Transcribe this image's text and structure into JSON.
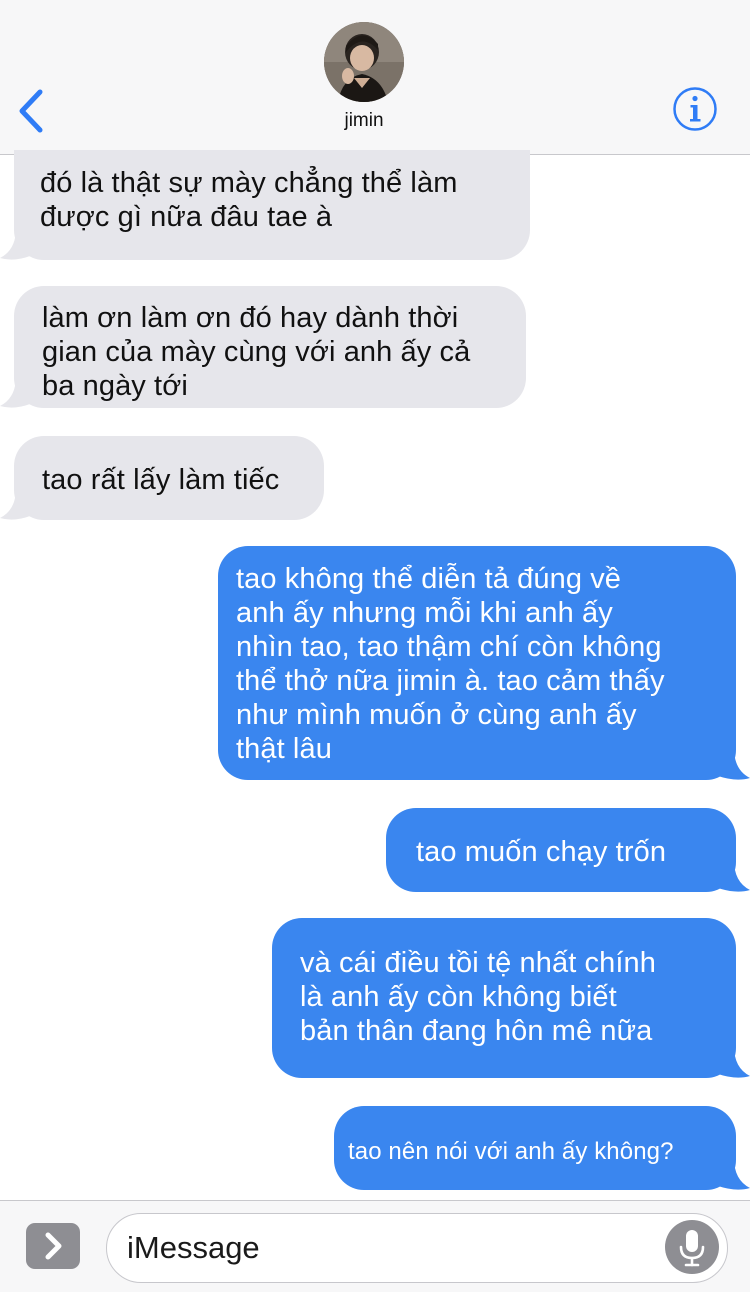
{
  "header": {
    "contact_name": "jimin"
  },
  "messages": [
    {
      "direction": "incoming",
      "text": "đó là thật sự mày chẳng thể làm\nđược gì nữa đâu tae à"
    },
    {
      "direction": "incoming",
      "text": "làm ơn làm ơn đó hay dành thời\ngian của mày cùng với anh ấy cả\nba ngày tới"
    },
    {
      "direction": "incoming",
      "text": "tao rất lấy làm tiếc"
    },
    {
      "direction": "outgoing",
      "text": "tao không thể diễn tả đúng về\nanh ấy nhưng mỗi khi anh ấy\nnhìn tao, tao thậm chí còn không\nthể thở nữa jimin à. tao cảm thấy\nnhư mình muốn ở cùng anh ấy\nthật lâu"
    },
    {
      "direction": "outgoing",
      "text": "tao muốn chạy trốn"
    },
    {
      "direction": "outgoing",
      "text": "và cái điều tồi tệ nhất chính\nlà anh ấy còn không biết\nbản thân đang hôn mê nữa"
    },
    {
      "direction": "outgoing",
      "text": "tao nên nói với anh ấy không?"
    }
  ],
  "composer": {
    "placeholder": "iMessage"
  },
  "colors": {
    "incoming_bubble": "#e6e6eb",
    "outgoing_bubble": "#3a86ef",
    "accent": "#2f7cf6"
  },
  "icons": {
    "back": "chevron-left-icon",
    "info": "info-icon",
    "expand": "chevron-right-icon",
    "mic": "microphone-icon"
  }
}
